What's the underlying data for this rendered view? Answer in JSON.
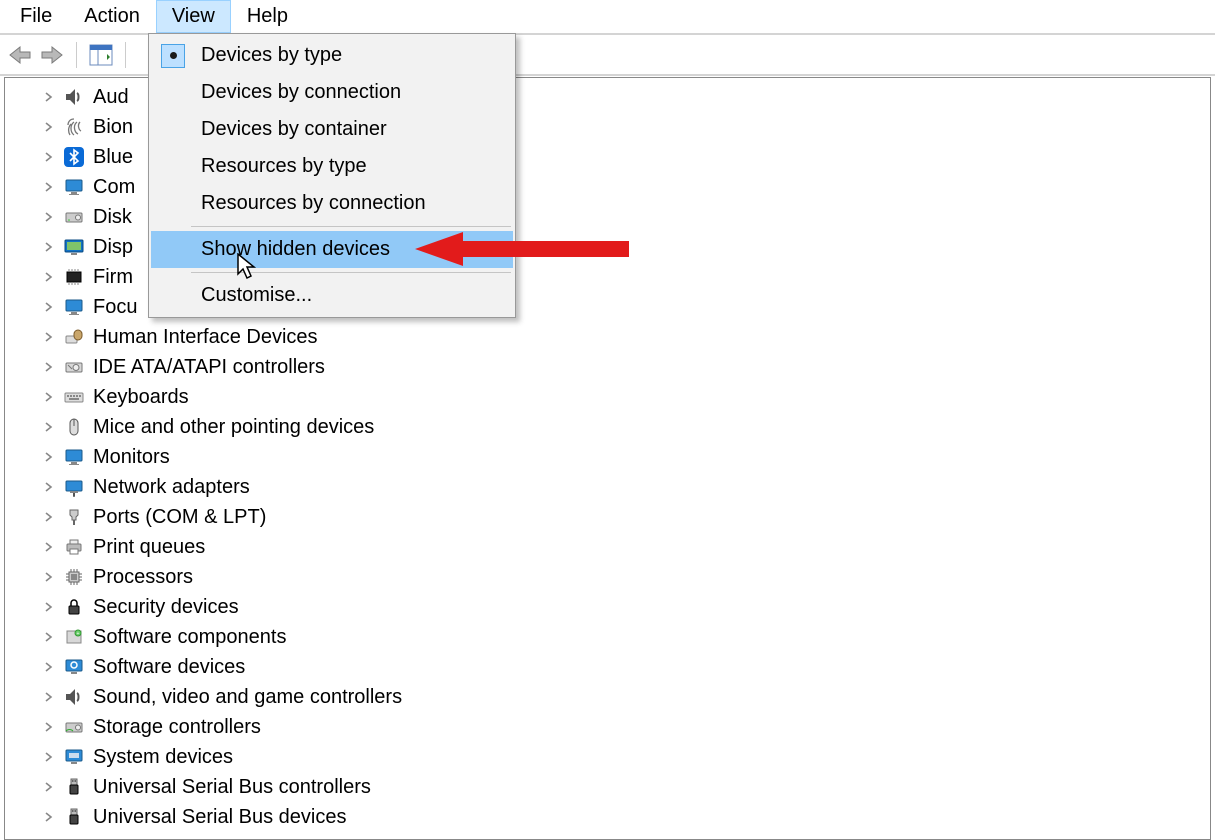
{
  "menubar": {
    "file": "File",
    "action": "Action",
    "view": "View",
    "help": "Help"
  },
  "dropdown": {
    "devices_by_type": "Devices by type",
    "devices_by_connection": "Devices by connection",
    "devices_by_container": "Devices by container",
    "resources_by_type": "Resources by type",
    "resources_by_connection": "Resources by connection",
    "show_hidden": "Show hidden devices",
    "customise": "Customise..."
  },
  "tree": [
    {
      "icon": "audio",
      "label": "Aud"
    },
    {
      "icon": "biometric",
      "label": "Bion"
    },
    {
      "icon": "bluetooth",
      "label": "Blue"
    },
    {
      "icon": "computer",
      "label": "Com"
    },
    {
      "icon": "disk",
      "label": "Disk"
    },
    {
      "icon": "display",
      "label": "Disp"
    },
    {
      "icon": "firmware",
      "label": "Firm"
    },
    {
      "icon": "focus",
      "label": "Focu"
    },
    {
      "icon": "hid",
      "label": "Human Interface Devices"
    },
    {
      "icon": "ide",
      "label": "IDE ATA/ATAPI controllers"
    },
    {
      "icon": "keyboard",
      "label": "Keyboards"
    },
    {
      "icon": "mouse",
      "label": "Mice and other pointing devices"
    },
    {
      "icon": "monitor",
      "label": "Monitors"
    },
    {
      "icon": "network",
      "label": "Network adapters"
    },
    {
      "icon": "ports",
      "label": "Ports (COM & LPT)"
    },
    {
      "icon": "print",
      "label": "Print queues"
    },
    {
      "icon": "cpu",
      "label": "Processors"
    },
    {
      "icon": "security",
      "label": "Security devices"
    },
    {
      "icon": "swcomp",
      "label": "Software components"
    },
    {
      "icon": "swdev",
      "label": "Software devices"
    },
    {
      "icon": "sound",
      "label": "Sound, video and game controllers"
    },
    {
      "icon": "storage",
      "label": "Storage controllers"
    },
    {
      "icon": "system",
      "label": "System devices"
    },
    {
      "icon": "usbctrl",
      "label": "Universal Serial Bus controllers"
    },
    {
      "icon": "usbdev",
      "label": "Universal Serial Bus devices"
    }
  ]
}
